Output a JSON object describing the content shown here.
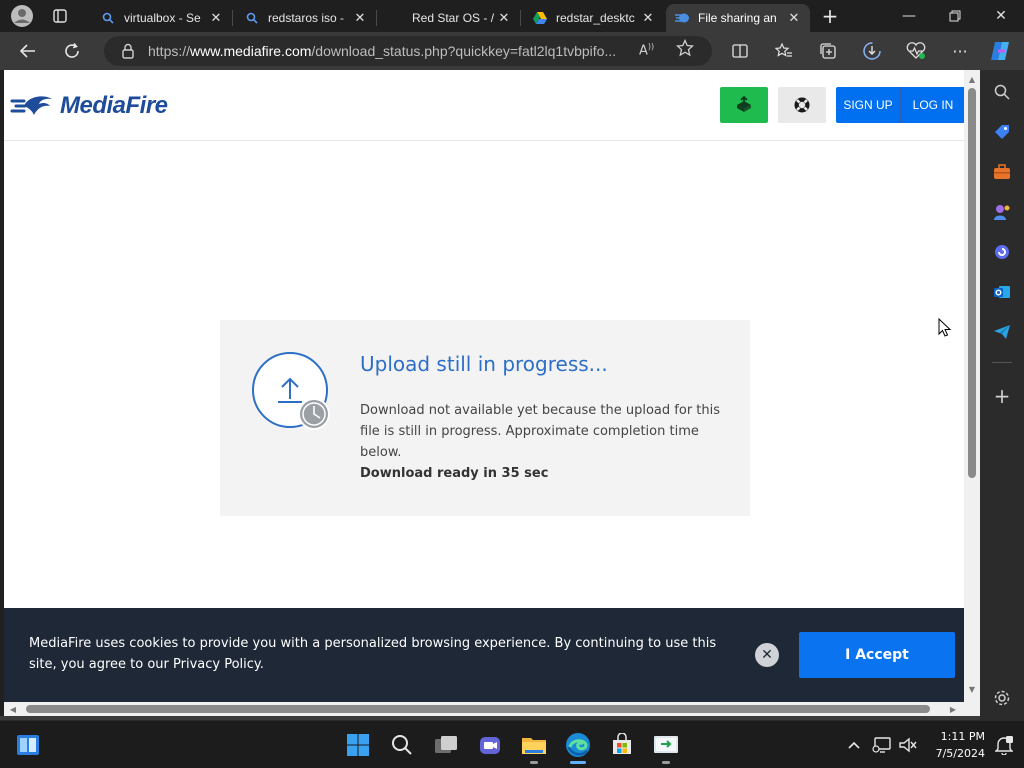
{
  "browser": {
    "tabs": [
      {
        "title": "virtualbox - Se",
        "icon": "search-icon"
      },
      {
        "title": "redstaros iso -",
        "icon": "search-icon"
      },
      {
        "title": "Red Star OS - /",
        "icon": "flag-icon"
      },
      {
        "title": "redstar_desktc",
        "icon": "drive-icon"
      },
      {
        "title": "File sharing an",
        "icon": "mediafire-icon",
        "active": true
      }
    ],
    "url_prefix": "https://",
    "url_host": "www.mediafire.com",
    "url_path": "/download_status.php?quickkey=fatl2lq1tvbpifo..."
  },
  "header": {
    "logo_text": "MediaFire",
    "signup_label": "SIGN UP",
    "login_label": "LOG IN",
    "upload_icon": "upload-icon",
    "help_icon": "lifebuoy-icon"
  },
  "status": {
    "title": "Upload still in progress...",
    "description": "Download not available yet because the upload for this file is still in progress. Approximate completion time below.",
    "ready_text": "Download ready in 35 sec"
  },
  "cookie": {
    "text": "MediaFire uses cookies to provide you with a personalized browsing experience. By continuing to use this site, you agree to our Privacy Policy.",
    "accept_label": "I Accept"
  },
  "taskbar": {
    "time": "1:11 PM",
    "date": "7/5/2024"
  },
  "colors": {
    "brand": "#1e4c9a",
    "accent": "#0070f0",
    "upload_green": "#1fbb4e",
    "status_blue": "#2d6fc7",
    "cookie_bg": "#1e2836"
  }
}
